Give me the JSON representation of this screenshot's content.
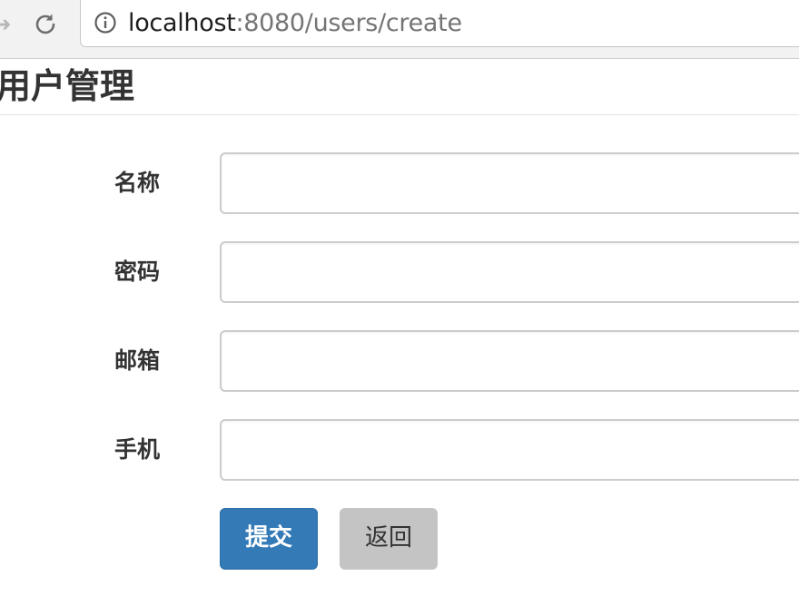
{
  "browser": {
    "url_host": "localhost",
    "url_path": ":8080/users/create"
  },
  "page": {
    "title": "用户管理"
  },
  "form": {
    "fields": [
      {
        "label": "名称",
        "value": ""
      },
      {
        "label": "密码",
        "value": ""
      },
      {
        "label": "邮箱",
        "value": ""
      },
      {
        "label": "手机",
        "value": ""
      }
    ],
    "submit_label": "提交",
    "back_label": "返回"
  },
  "colors": {
    "primary": "#337ab7",
    "secondary": "#c4c4c4",
    "text": "#333333"
  },
  "icons": {
    "forward": "arrow-right-icon",
    "reload": "reload-icon",
    "info": "info-icon"
  }
}
